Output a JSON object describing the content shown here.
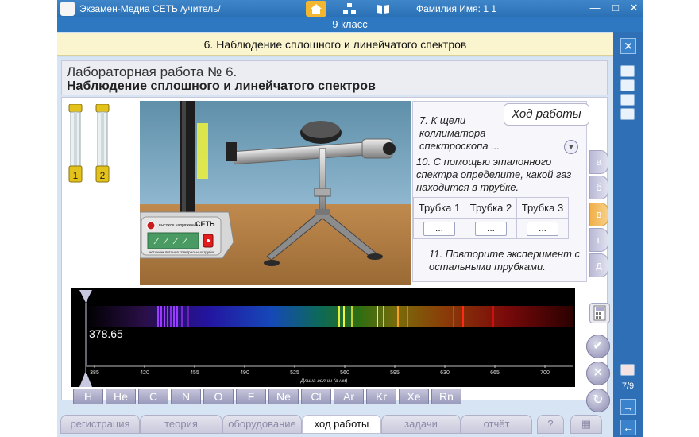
{
  "window": {
    "title": "Экзамен-Медиа СЕТЬ /учитель/",
    "student": "Фамилия Имя:  1 1",
    "class_label": "9 класс"
  },
  "topic": "6. Наблюдение сплошного и линейчатого спектров",
  "lab": {
    "title_line1": "Лабораторная работа № 6.",
    "title_line2": "Наблюдение сплошного и линейчатого спектров"
  },
  "tubes": [
    {
      "label": "1"
    },
    {
      "label": "2"
    }
  ],
  "apparatus": {
    "power_label": "СЕТЬ",
    "indicator_text": "высокое напряжение",
    "panel_text": "источник питания спектральных трубок"
  },
  "instructions": {
    "header": "Ход работы",
    "step7": "7. К щели коллиматора спектроскопа ...",
    "step10": "10. С помощью эталонного спектра определите, какой газ находится в трубке.",
    "table_headers": [
      "Трубка 1",
      "Трубка 2",
      "Трубка 3"
    ],
    "table_values": [
      "...",
      "...",
      "..."
    ],
    "step11": "11. Повторите эксперимент с остальными трубками."
  },
  "side_tabs": [
    {
      "label": "а",
      "active": false
    },
    {
      "label": "б",
      "active": false
    },
    {
      "label": "в",
      "active": true
    },
    {
      "label": "г",
      "active": false
    },
    {
      "label": "д",
      "active": false
    }
  ],
  "spectrum": {
    "readout": "378.65",
    "axis_label": "Длина волны (в нм)",
    "ticks": [
      "385",
      "420",
      "455",
      "490",
      "525",
      "560",
      "595",
      "630",
      "665",
      "700"
    ],
    "elements": [
      "H",
      "He",
      "C",
      "N",
      "O",
      "F",
      "Ne",
      "Cl",
      "Ar",
      "Kr",
      "Xe",
      "Rn"
    ]
  },
  "bottom_tabs": [
    {
      "label": "регистрация",
      "active": false
    },
    {
      "label": "теория",
      "active": false
    },
    {
      "label": "оборудование",
      "active": false
    },
    {
      "label": "ход работы",
      "active": true
    },
    {
      "label": "задачи",
      "active": false
    },
    {
      "label": "отчёт",
      "active": false
    }
  ],
  "rail": {
    "close_glyph": "✕",
    "page_indicator": "7/9"
  },
  "colors": {
    "titlebar": "#2a6fb4",
    "topic_bg": "#fbf5cf",
    "active_tab": "#f0b04a"
  }
}
